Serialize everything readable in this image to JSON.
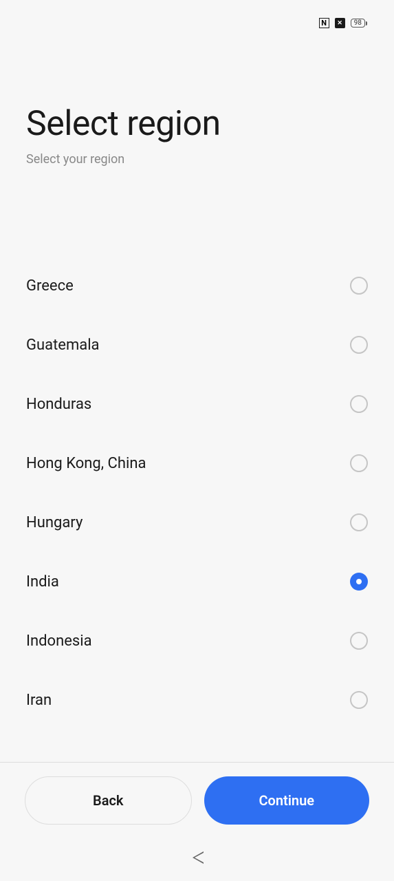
{
  "status": {
    "battery": "98"
  },
  "header": {
    "title": "Select region",
    "subtitle": "Select your region"
  },
  "regions": [
    {
      "label": "Greece",
      "selected": false
    },
    {
      "label": "Guatemala",
      "selected": false
    },
    {
      "label": "Honduras",
      "selected": false
    },
    {
      "label": "Hong Kong, China",
      "selected": false
    },
    {
      "label": "Hungary",
      "selected": false
    },
    {
      "label": "India",
      "selected": true
    },
    {
      "label": "Indonesia",
      "selected": false
    },
    {
      "label": "Iran",
      "selected": false
    }
  ],
  "buttons": {
    "back": "Back",
    "continue": "Continue"
  }
}
